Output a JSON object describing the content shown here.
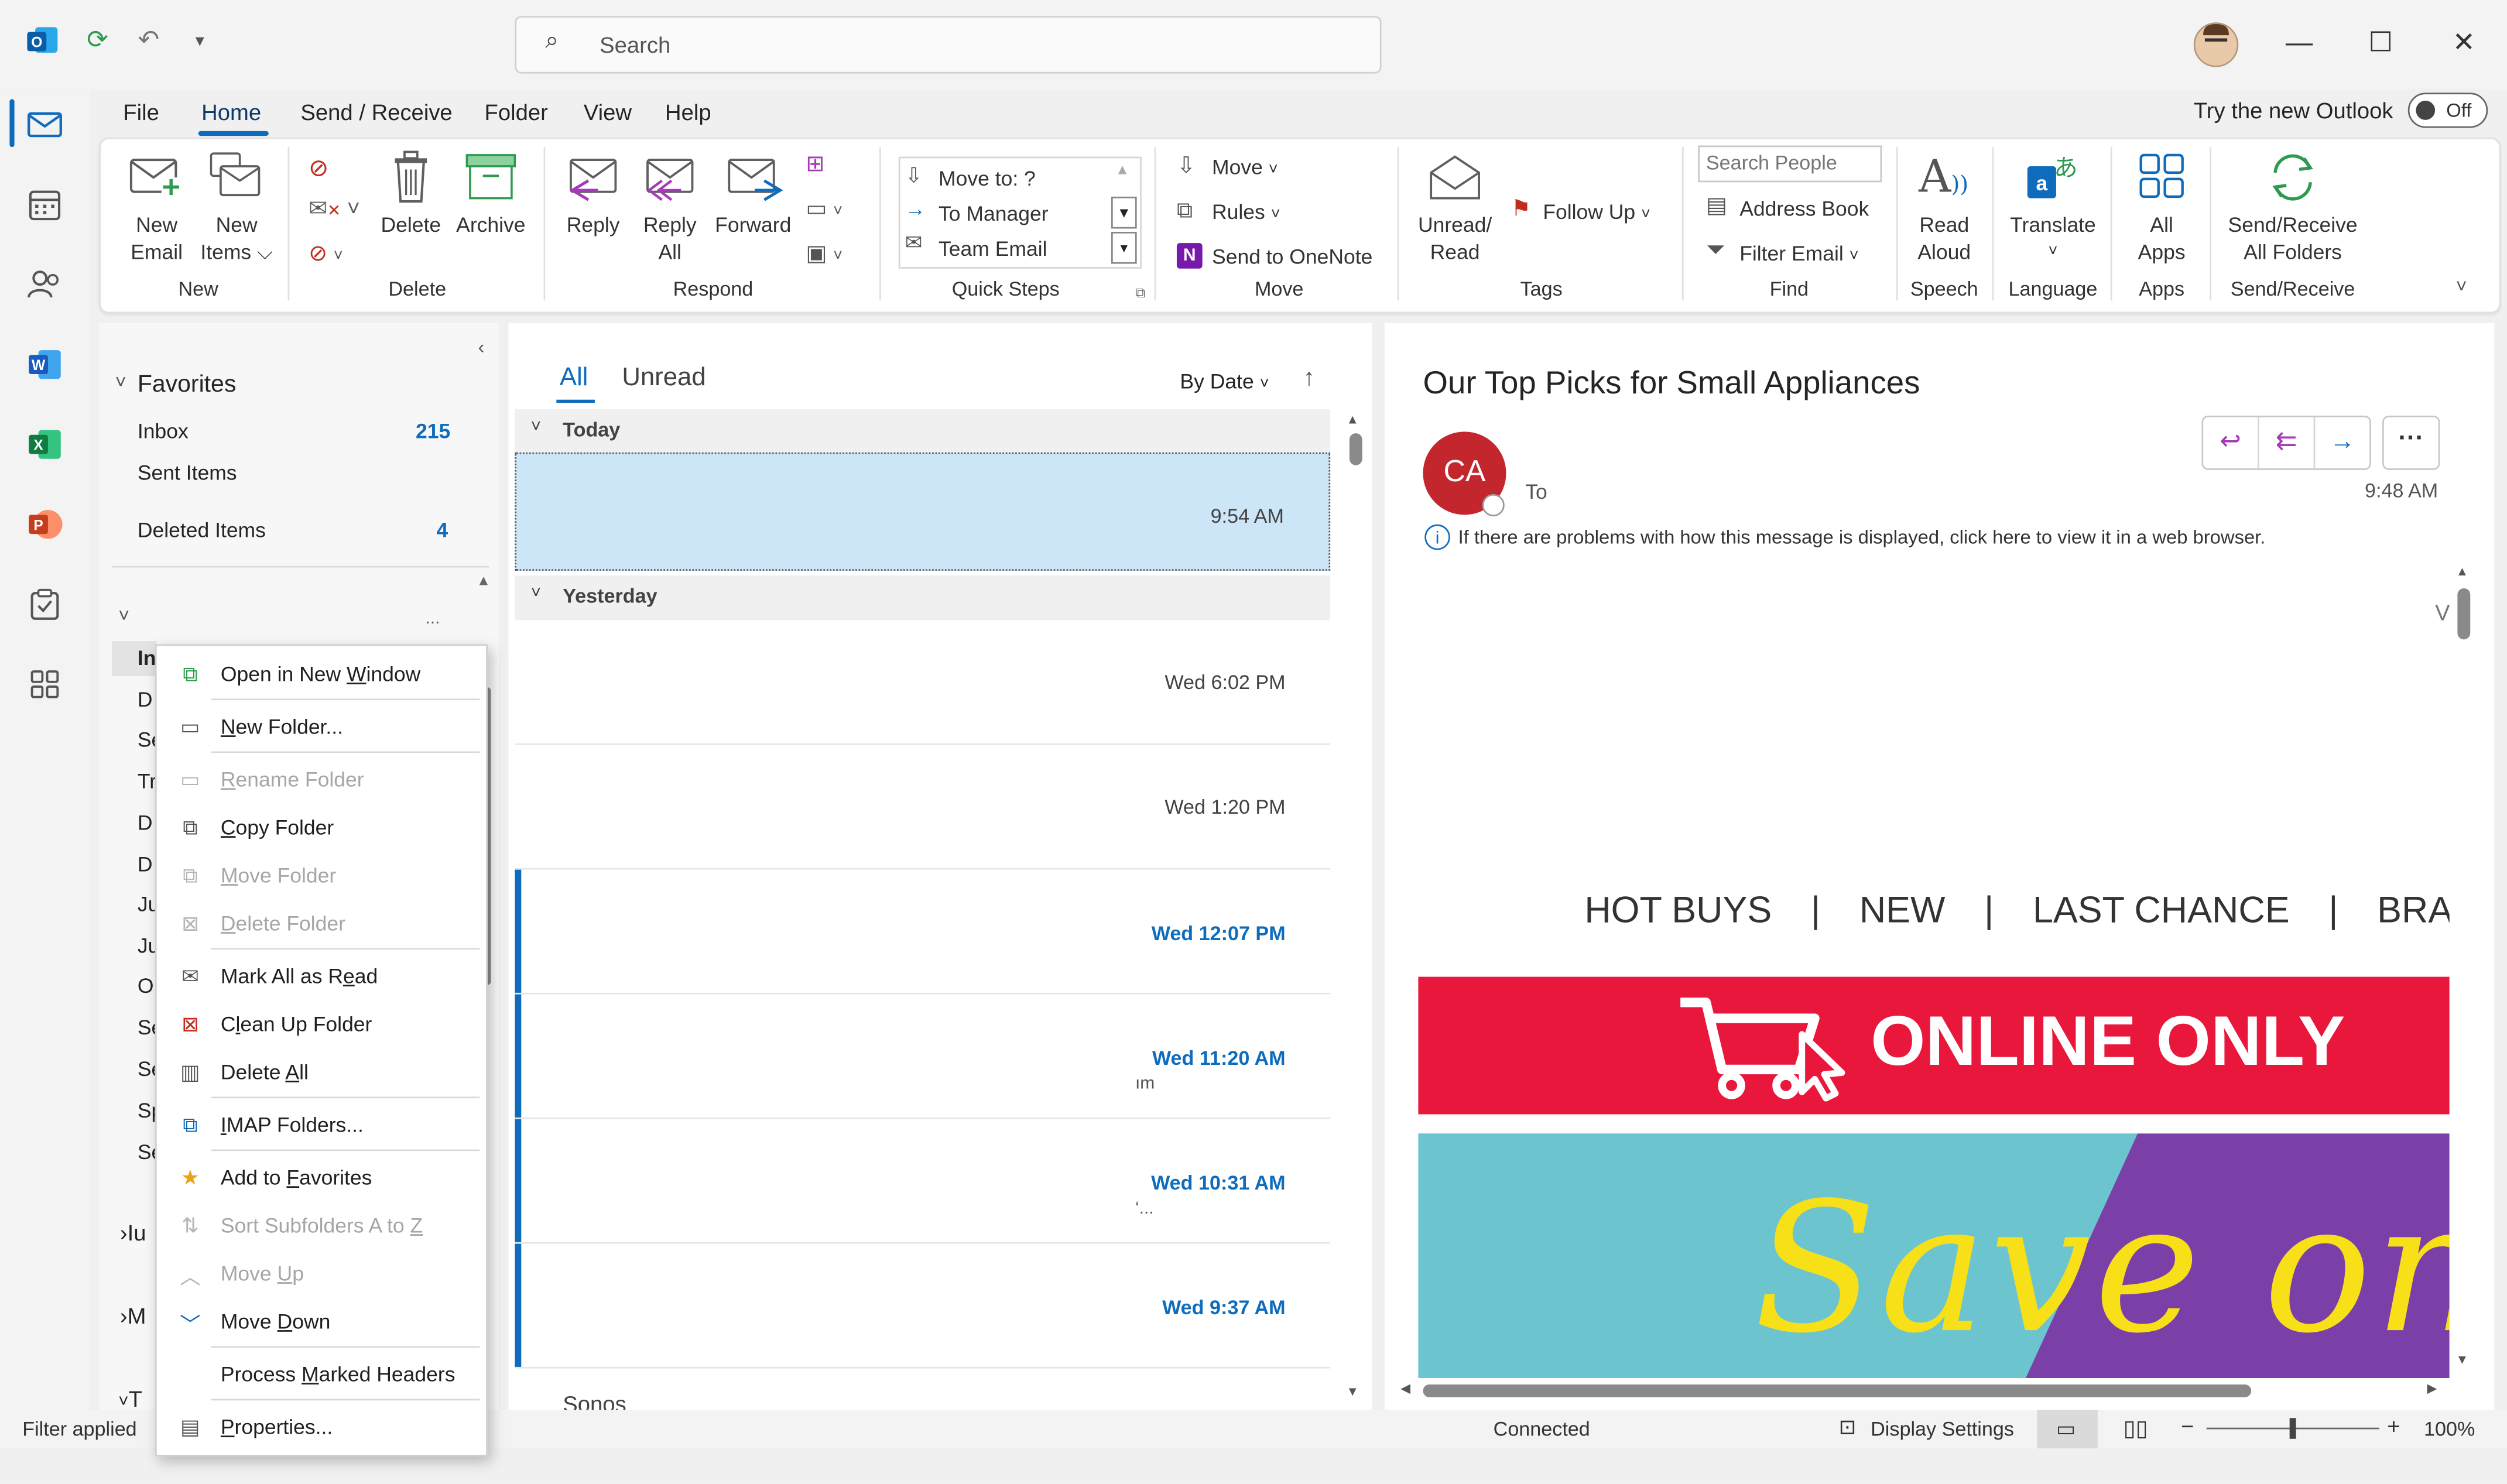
{
  "titlebar": {
    "search_placeholder": "Search"
  },
  "menu_tabs": [
    "File",
    "Home",
    "Send / Receive",
    "Folder",
    "View",
    "Help"
  ],
  "try_new_outlook": {
    "label": "Try the new Outlook",
    "toggle_state": "Off"
  },
  "ribbon": {
    "new": {
      "new_email": [
        "New",
        "Email"
      ],
      "new_items": [
        "New",
        "Items ⌵"
      ],
      "group": "New"
    },
    "delete": {
      "delete": "Delete",
      "archive": "Archive",
      "group": "Delete"
    },
    "respond": {
      "reply": "Reply",
      "reply_all": [
        "Reply",
        "All"
      ],
      "forward": "Forward",
      "group": "Respond"
    },
    "quick_steps": {
      "items": [
        "Move to: ?",
        "To Manager",
        "Team Email"
      ],
      "group": "Quick Steps"
    },
    "move": {
      "move": "Move",
      "rules": "Rules",
      "onenote": "Send to OneNote",
      "group": "Move"
    },
    "tags": {
      "unread_read": [
        "Unread/",
        "Read"
      ],
      "follow_up": "Follow Up",
      "group": "Tags"
    },
    "find": {
      "search_people": "Search People",
      "address_book": "Address Book",
      "filter_email": "Filter Email",
      "group": "Find"
    },
    "speech": {
      "read_aloud": [
        "Read",
        "Aloud"
      ],
      "group": "Speech"
    },
    "language": {
      "translate": "Translate",
      "group": "Language"
    },
    "apps": {
      "all_apps": [
        "All",
        "Apps"
      ],
      "group": "Apps"
    },
    "send_receive": {
      "label": [
        "Send/Receive",
        "All Folders"
      ],
      "group": "Send/Receive"
    }
  },
  "folder_pane": {
    "favorites_label": "Favorites",
    "favorites": [
      {
        "name": "Inbox",
        "count": "215"
      },
      {
        "name": "Sent Items",
        "count": ""
      },
      {
        "name": "Deleted Items",
        "count": "4"
      }
    ],
    "folder_letters": [
      "In",
      "D",
      "Se",
      "Tr",
      "D",
      "D",
      "Ju",
      "Ju",
      "O",
      "Se",
      "Se",
      "Sp",
      "Se"
    ],
    "collapsed_roots": [
      "Iu",
      "M",
      "T"
    ]
  },
  "mail_list": {
    "tabs": {
      "all": "All",
      "unread": "Unread"
    },
    "sort": "By Date",
    "groups": {
      "today": "Today",
      "yesterday": "Yesterday"
    },
    "items": [
      {
        "time": "9:54 AM",
        "snippet": ""
      },
      {
        "time": "Wed 6:02 PM",
        "snippet": ""
      },
      {
        "time": "Wed 1:20 PM",
        "snippet": ""
      },
      {
        "time": "Wed 12:07 PM",
        "snippet": ""
      },
      {
        "time": "Wed 11:20 AM",
        "snippet": "ım"
      },
      {
        "time": "Wed 10:31 AM",
        "snippet": "‘..."
      },
      {
        "time": "Wed 9:37 AM",
        "snippet": ""
      }
    ],
    "partial_sender": "Sonos"
  },
  "reading_pane": {
    "subject": "Our Top Picks for Small Appliances",
    "avatar_initials": "CA",
    "to_label": "To",
    "time": "9:48 AM",
    "info_bar": "If there are problems with how this message is displayed, click here to view it in a web browser.",
    "nav": [
      "HOT BUYS",
      "|",
      "NEW",
      "|",
      "LAST CHANCE",
      "|",
      "BRANDS"
    ],
    "banner": "ONLINE ONLY",
    "hero_script": "Save on",
    "scroll_glyph": "V"
  },
  "context_menu": {
    "items": [
      {
        "label": "Open in New Window",
        "u": "W",
        "disabled": false,
        "icon": "new-window-icon"
      },
      {
        "label": "New Folder...",
        "u": "N",
        "disabled": false,
        "icon": "folder-icon"
      },
      {
        "label": "Rename Folder",
        "u": "R",
        "disabled": true,
        "icon": "rename-folder-icon"
      },
      {
        "label": "Copy Folder",
        "u": "C",
        "disabled": false,
        "icon": "copy-folder-icon"
      },
      {
        "label": "Move Folder",
        "u": "M",
        "disabled": true,
        "icon": "move-folder-icon"
      },
      {
        "label": "Delete Folder",
        "u": "D",
        "disabled": true,
        "icon": "delete-folder-icon"
      },
      {
        "label": "Mark All as Read",
        "u": "e",
        "disabled": false,
        "icon": "mark-read-icon"
      },
      {
        "label": "Clean Up Folder",
        "u": "l",
        "disabled": false,
        "icon": "clean-up-icon"
      },
      {
        "label": "Delete All",
        "u": "A",
        "disabled": false,
        "icon": "delete-all-icon"
      },
      {
        "label": "IMAP Folders...",
        "u": "I",
        "disabled": false,
        "icon": "imap-folders-icon"
      },
      {
        "label": "Add to Favorites",
        "u": "F",
        "disabled": false,
        "icon": "favorites-star-icon"
      },
      {
        "label": "Sort Subfolders A to Z",
        "u": "Z",
        "disabled": true,
        "icon": "sort-az-icon"
      },
      {
        "label": "Move Up",
        "u": "U",
        "disabled": true,
        "icon": "chevron-up-icon"
      },
      {
        "label": "Move Down",
        "u": "D",
        "disabled": false,
        "icon": "chevron-down-icon"
      },
      {
        "label": "Process Marked Headers",
        "u": "M",
        "disabled": false,
        "icon": ""
      },
      {
        "label": "Properties...",
        "u": "P",
        "disabled": false,
        "icon": "properties-icon"
      }
    ]
  },
  "status_bar": {
    "filter": "Filter applied",
    "connection": "Connected",
    "display_settings": "Display Settings",
    "zoom": "100%"
  },
  "colors": {
    "accent": "#0f6cbd",
    "selected_row": "#cde6f7",
    "avatar": "#c4262e",
    "banner_red": "#e8173b",
    "hero_teal": "#6cc4cf",
    "hero_purple": "#7b3fa8",
    "hero_yellow": "#f7e017"
  }
}
